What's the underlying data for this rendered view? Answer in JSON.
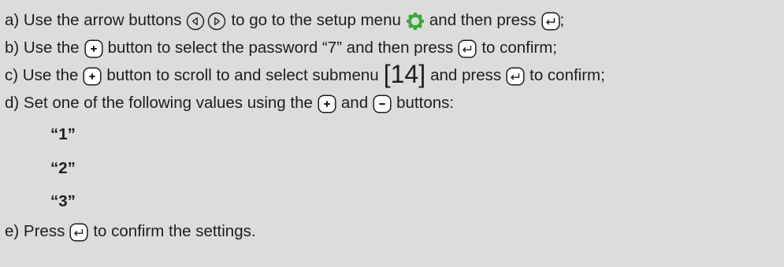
{
  "steps": {
    "a": {
      "part1": "a) Use the arrow buttons",
      "part2": "to go to the setup menu",
      "part3": "and then press",
      "part4": ";"
    },
    "b": {
      "part1": "b) Use the",
      "part2": "button to select the password “7” and then press",
      "part3": "to confirm;"
    },
    "c": {
      "part1": "c) Use the",
      "part2": "button to scroll to and select submenu",
      "submenu": "[14]",
      "part3": "and press",
      "part4": "to confirm;"
    },
    "d": {
      "part1": "d) Set one of the following values using the",
      "part2": "and",
      "part3": "buttons:"
    },
    "values": [
      "“1”",
      "“2”",
      "“3”"
    ],
    "e": {
      "part1": "e) Press",
      "part2": "to confirm the settings."
    }
  },
  "icons": {
    "left_arrow": "left-arrow-circle-icon",
    "right_arrow": "right-arrow-circle-icon",
    "setup": "gear-icon",
    "enter": "enter-icon",
    "plus": "plus-icon",
    "minus": "minus-icon"
  },
  "colors": {
    "background": "#dcdcdc",
    "text": "#1d1d1b",
    "gear": "#3aaa35"
  }
}
